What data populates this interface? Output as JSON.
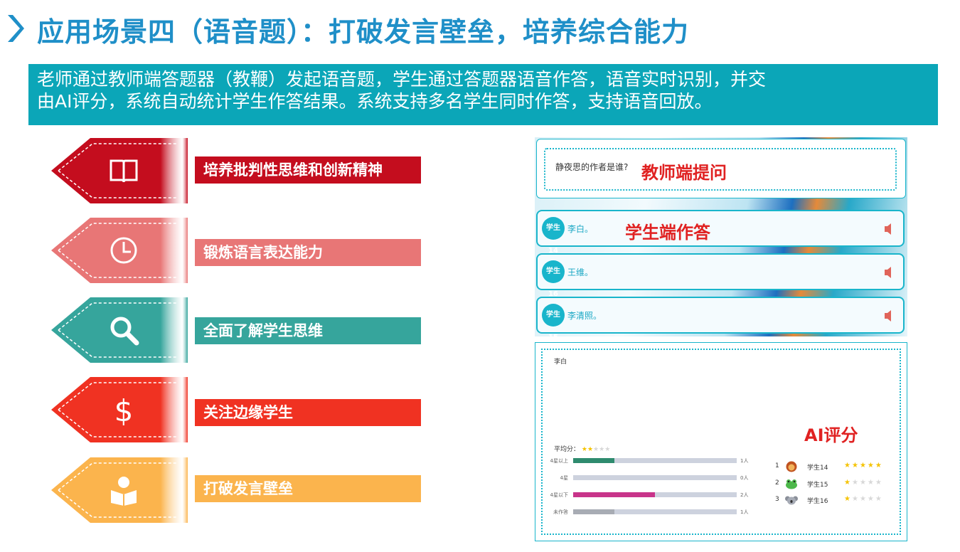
{
  "header": {
    "title": "应用场景四（语音题）：打破发言壁垒，培养综合能力"
  },
  "intro": {
    "line1": "老师通过教师端答题器（教鞭）发起语音题，学生通过答题器语音作答，语音实时识别，并交",
    "line2": "由AI评分，系统自动统计学生作答结果。系统支持多名学生同时作答，支持语音回放。"
  },
  "features": [
    {
      "label": "培养批判性思维和创新精神",
      "icon": "book-icon",
      "color": "#c40d1e"
    },
    {
      "label": "锻炼语言表达能力",
      "icon": "clock-icon",
      "color": "#e87676"
    },
    {
      "label": "全面了解学生思维",
      "icon": "search-icon",
      "color": "#36a59c"
    },
    {
      "label": "关注边缘学生",
      "icon": "dollar-icon",
      "color": "#f03222"
    },
    {
      "label": "打破发言壁垒",
      "icon": "reader-icon",
      "color": "#fbb44d"
    }
  ],
  "teacher_panel": {
    "question": "静夜思的作者是谁?",
    "question_note": "教师端提问",
    "answer_note": "学生端作答",
    "answers": [
      {
        "student": "学生14",
        "text": "李白。"
      },
      {
        "student": "学生16",
        "text": "王维。"
      },
      {
        "student": "学生15",
        "text": "李清照。"
      }
    ]
  },
  "score_panel": {
    "answer": "李白",
    "note": "AI评分",
    "avg_label": "平均分：",
    "avg_stars": 2,
    "distribution": [
      {
        "label": "4星以上",
        "value": 1,
        "count": "1人",
        "color": "#2e8b6e"
      },
      {
        "label": "4星",
        "value": 0,
        "count": "0人",
        "color": "#2e8b6e"
      },
      {
        "label": "4星以下",
        "value": 2,
        "count": "2人",
        "color": "#c8348a"
      },
      {
        "label": "未作答",
        "value": 1,
        "count": "1人",
        "color": "#a8acb4"
      }
    ],
    "ranking": [
      {
        "rank": "1",
        "name": "学生14",
        "stars": 5,
        "avatar": "lion-avatar-icon"
      },
      {
        "rank": "2",
        "name": "学生15",
        "stars": 1,
        "avatar": "frog-avatar-icon"
      },
      {
        "rank": "3",
        "name": "学生16",
        "stars": 1,
        "avatar": "koala-avatar-icon"
      }
    ]
  }
}
